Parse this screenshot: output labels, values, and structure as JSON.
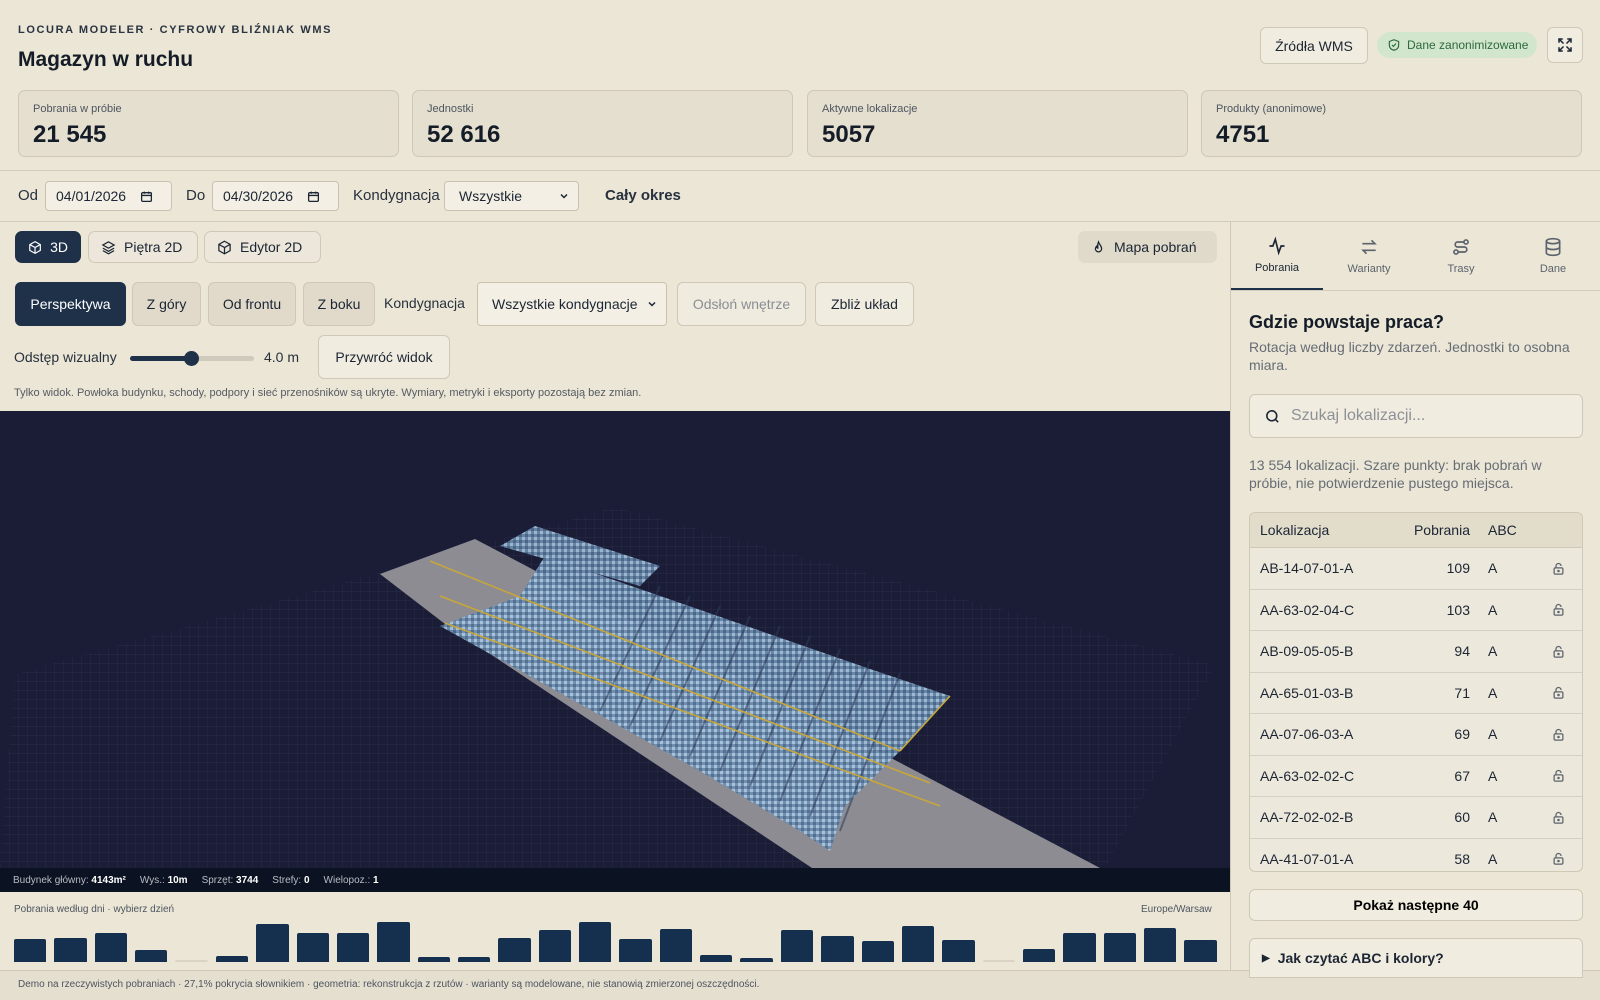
{
  "header": {
    "eyebrow": "LOCURA MODELER · CYFROWY BLIŹNIAK WMS",
    "title": "Magazyn w ruchu",
    "sources_button": "Źródła WMS",
    "anon_badge": "Dane zanonimizowane",
    "fullscreen_icon": "expand-icon"
  },
  "kpis": [
    {
      "label": "Pobrania w próbie",
      "value": "21 545"
    },
    {
      "label": "Jednostki",
      "value": "52 616"
    },
    {
      "label": "Aktywne lokalizacje",
      "value": "5057"
    },
    {
      "label": "Produkty (anonimowe)",
      "value": "4751"
    }
  ],
  "filters": {
    "from_label": "Od",
    "from_value": "04/01/2026",
    "to_label": "Do",
    "to_value": "04/30/2026",
    "floor_label": "Kondygnacja",
    "floor_value": "Wszystkie",
    "whole_period": "Cały okres"
  },
  "view_tabs": [
    {
      "label": "3D",
      "icon": "cube-icon",
      "active": true
    },
    {
      "label": "Piętra 2D",
      "icon": "layers-icon",
      "active": false
    },
    {
      "label": "Edytor 2D",
      "icon": "box-icon",
      "active": false
    }
  ],
  "heatmap_button": "Mapa pobrań",
  "projection": {
    "perspective": "Perspektywa",
    "top": "Z góry",
    "front": "Od frontu",
    "side": "Z boku",
    "floor_label": "Kondygnacja",
    "floor_value": "Wszystkie kondygnacje",
    "reveal": "Odsłoń wnętrze",
    "zoom": "Zbliż układ"
  },
  "spacing": {
    "label": "Odstęp wizualny",
    "value": "4.0 m",
    "level_fraction": 0.5,
    "reset": "Przywróć widok"
  },
  "view_note": "Tylko widok. Powłoka budynku, schody, podpory i sieć przenośników są ukryte. Wymiary, metryki i eksporty pozostają bez zmian.",
  "stats": {
    "building_label": "Budynek główny:",
    "building_value": "4143m²",
    "height_label": "Wys.:",
    "height_value": "10m",
    "equipment_label": "Sprzęt:",
    "equipment_value": "3744",
    "zones_label": "Strefy:",
    "zones_value": "0",
    "multi_label": "Wielopoz.:",
    "multi_value": "1"
  },
  "timeline": {
    "label": "Pobrania według dni · wybierz dzień",
    "timezone": "Europe/Warsaw"
  },
  "chart_data": {
    "type": "bar",
    "values": [
      22,
      23,
      28,
      11,
      0,
      6,
      36,
      28,
      28,
      38,
      5,
      5,
      23,
      30,
      38,
      22,
      31,
      7,
      4,
      30,
      25,
      20,
      34,
      21,
      0,
      12,
      28,
      28,
      32,
      21
    ]
  },
  "footer": "Demo na rzeczywistych pobraniach · 27,1% pokrycia słownikiem · geometria: rekonstrukcja z rzutów · warianty są modelowane, nie stanowią zmierzonej oszczędności.",
  "right_panel": {
    "tabs": [
      {
        "label": "Pobrania",
        "icon": "activity-icon",
        "active": true
      },
      {
        "label": "Warianty",
        "icon": "swap-icon",
        "active": false
      },
      {
        "label": "Trasy",
        "icon": "route-icon",
        "active": false
      },
      {
        "label": "Dane",
        "icon": "database-icon",
        "active": false
      }
    ],
    "title": "Gdzie powstaje praca?",
    "subtitle": "Rotacja według liczby zdarzeń. Jednostki to osobna miara.",
    "search_placeholder": "Szukaj lokalizacji...",
    "info": "13 554 lokalizacji. Szare punkty: brak pobrań w próbie, nie potwierdzenie pustego miejsca.",
    "columns": {
      "location": "Lokalizacja",
      "picks": "Pobrania",
      "abc": "ABC"
    },
    "rows": [
      {
        "location": "AB-14-07-01-A",
        "picks": "109",
        "abc": "A"
      },
      {
        "location": "AA-63-02-04-C",
        "picks": "103",
        "abc": "A"
      },
      {
        "location": "AB-09-05-05-B",
        "picks": "94",
        "abc": "A"
      },
      {
        "location": "AA-65-01-03-B",
        "picks": "71",
        "abc": "A"
      },
      {
        "location": "AA-07-06-03-A",
        "picks": "69",
        "abc": "A"
      },
      {
        "location": "AA-63-02-02-C",
        "picks": "67",
        "abc": "A"
      },
      {
        "location": "AA-72-02-02-B",
        "picks": "60",
        "abc": "A"
      },
      {
        "location": "AA-41-07-01-A",
        "picks": "58",
        "abc": "A"
      }
    ],
    "more_button": "Pokaż następne 40",
    "howto": "Jak czytać ABC i kolory?"
  }
}
